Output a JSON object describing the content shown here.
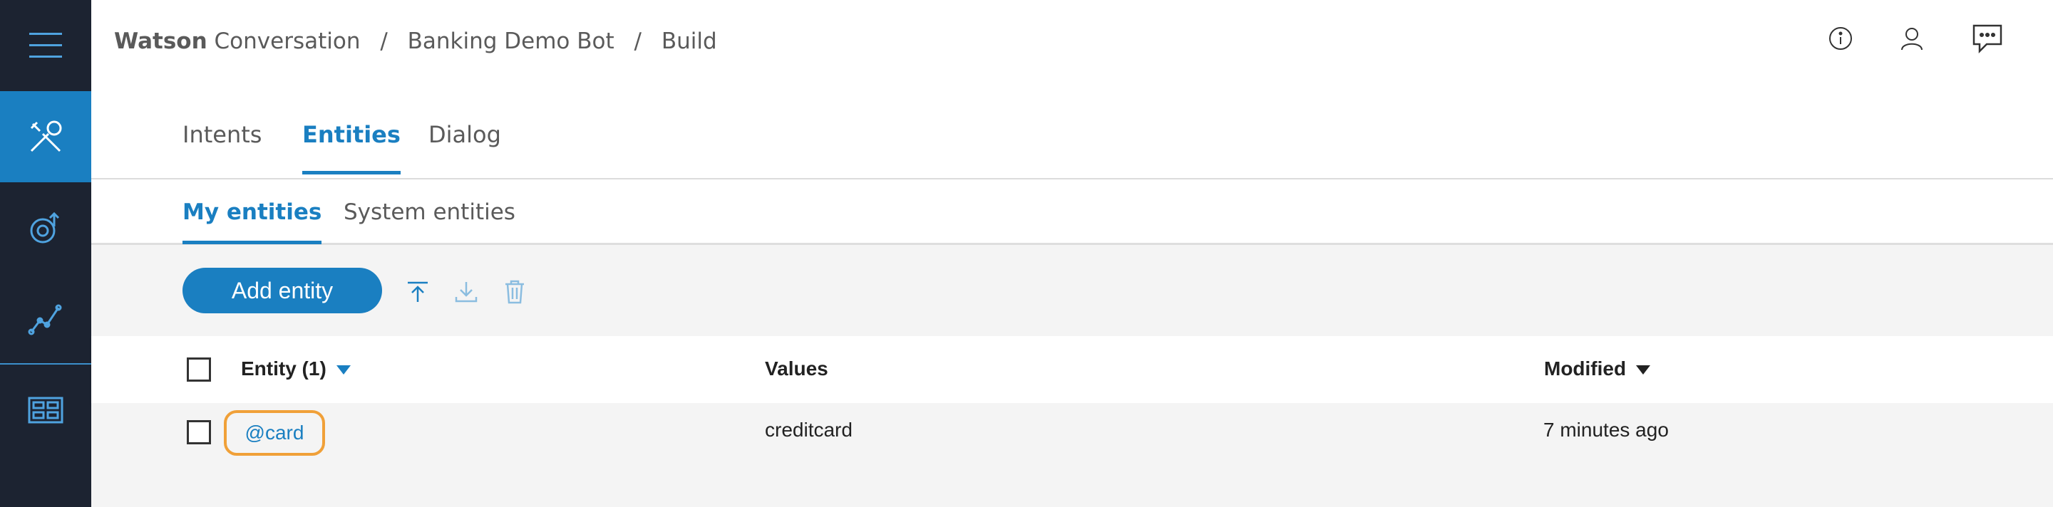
{
  "breadcrumb": {
    "brand": "Watson",
    "product": "Conversation",
    "workspace": "Banking Demo Bot",
    "section": "Build",
    "separator": "/"
  },
  "sidebar": {
    "items": [
      {
        "icon": "menu-icon"
      },
      {
        "icon": "build-tools-icon",
        "active": true
      },
      {
        "icon": "improve-icon"
      },
      {
        "icon": "analytics-icon"
      },
      {
        "icon": "workspaces-icon"
      }
    ]
  },
  "header_icons": [
    "info-icon",
    "user-icon",
    "chat-icon"
  ],
  "tabs": [
    {
      "label": "Intents"
    },
    {
      "label": "Entities",
      "active": true
    },
    {
      "label": "Dialog"
    }
  ],
  "subtabs": [
    {
      "label": "My entities",
      "active": true
    },
    {
      "label": "System entities"
    }
  ],
  "toolbar": {
    "add_label": "Add entity",
    "icons": [
      "upload-icon",
      "download-icon",
      "trash-icon"
    ]
  },
  "table": {
    "columns": {
      "entity": "Entity (1)",
      "values": "Values",
      "modified": "Modified"
    },
    "rows": [
      {
        "entity": "@card",
        "values": "creditcard",
        "modified": "7 minutes ago"
      }
    ]
  },
  "colors": {
    "accent": "#1a7fc1",
    "sidebar": "#1c2331",
    "highlight": "#f0a038"
  }
}
